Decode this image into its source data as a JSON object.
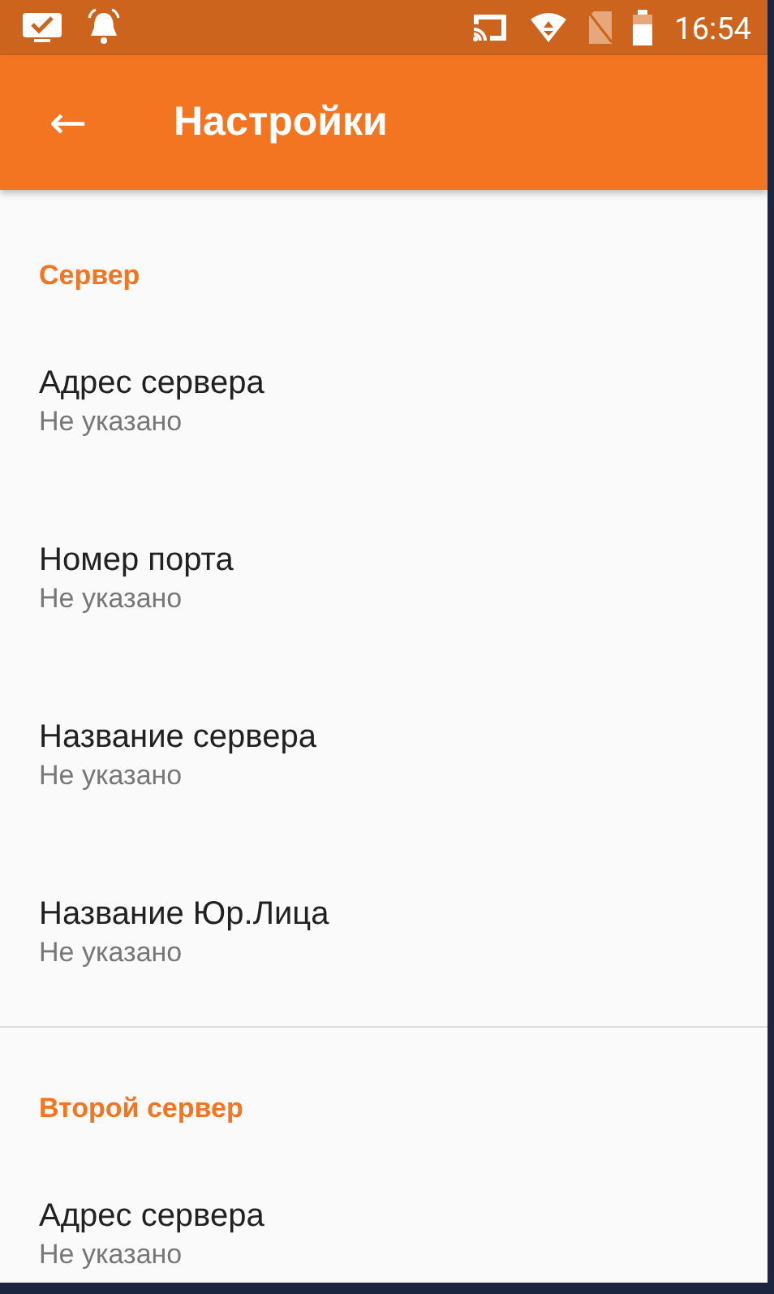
{
  "status_bar": {
    "time": "16:54"
  },
  "app_bar": {
    "back": "←",
    "title": "Настройки"
  },
  "sections": [
    {
      "title": "Сервер",
      "items": [
        {
          "title": "Адрес сервера",
          "summary": "Не указано"
        },
        {
          "title": "Номер порта",
          "summary": "Не указано"
        },
        {
          "title": "Название сервера",
          "summary": "Не указано"
        },
        {
          "title": "Название Юр.Лица",
          "summary": "Не указано"
        }
      ]
    },
    {
      "title": "Второй сервер",
      "items": [
        {
          "title": "Адрес сервера",
          "summary": "Не указано"
        }
      ]
    }
  ]
}
